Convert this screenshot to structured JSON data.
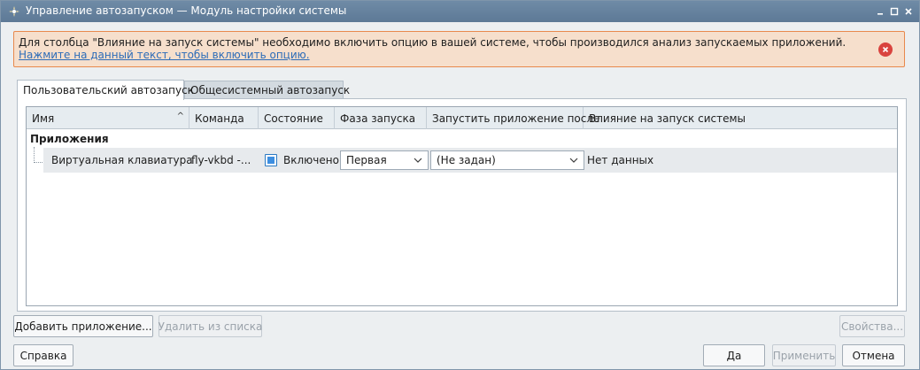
{
  "window": {
    "title": "Управление автозапуском — Модуль настройки системы",
    "controls": [
      "minimize-icon",
      "maximize-icon",
      "close-icon"
    ]
  },
  "banner": {
    "text": "Для столбца \"Влияние на запуск системы\" необходимо включить опцию в вашей системе, чтобы производился анализ запускаемых приложений. ",
    "link_text": "Нажмите на данный текст, чтобы включить опцию.",
    "close_icon": "error-close-icon",
    "colors": {
      "background": "#f6dfcc",
      "border": "#e8894d"
    }
  },
  "tabs": [
    {
      "label": "Пользовательский автозапуск",
      "active": true
    },
    {
      "label": "Общесистемный автозапуск",
      "active": false
    }
  ],
  "table": {
    "columns": [
      "Имя",
      "Команда",
      "Состояние",
      "Фаза запуска",
      "Запустить приложение после",
      "Влияние на запуск системы"
    ],
    "sort_indicator": "^",
    "group": "Приложения",
    "rows": [
      {
        "name": "Виртуальная клавиатура",
        "command": "fly-vkbd -...",
        "state": "Включено",
        "state_checked": true,
        "phase": "Первая",
        "start_after": "(Не задан)",
        "impact": "Нет данных"
      }
    ]
  },
  "buttons": {
    "add": "Добавить приложение...",
    "remove": "Удалить из списка",
    "properties": "Свойства...",
    "help": "Справка",
    "ok": "Да",
    "apply": "Применить",
    "cancel": "Отмена"
  },
  "colors": {
    "accent": "#3d8ee0",
    "titlebar": "#6f8ba6"
  }
}
